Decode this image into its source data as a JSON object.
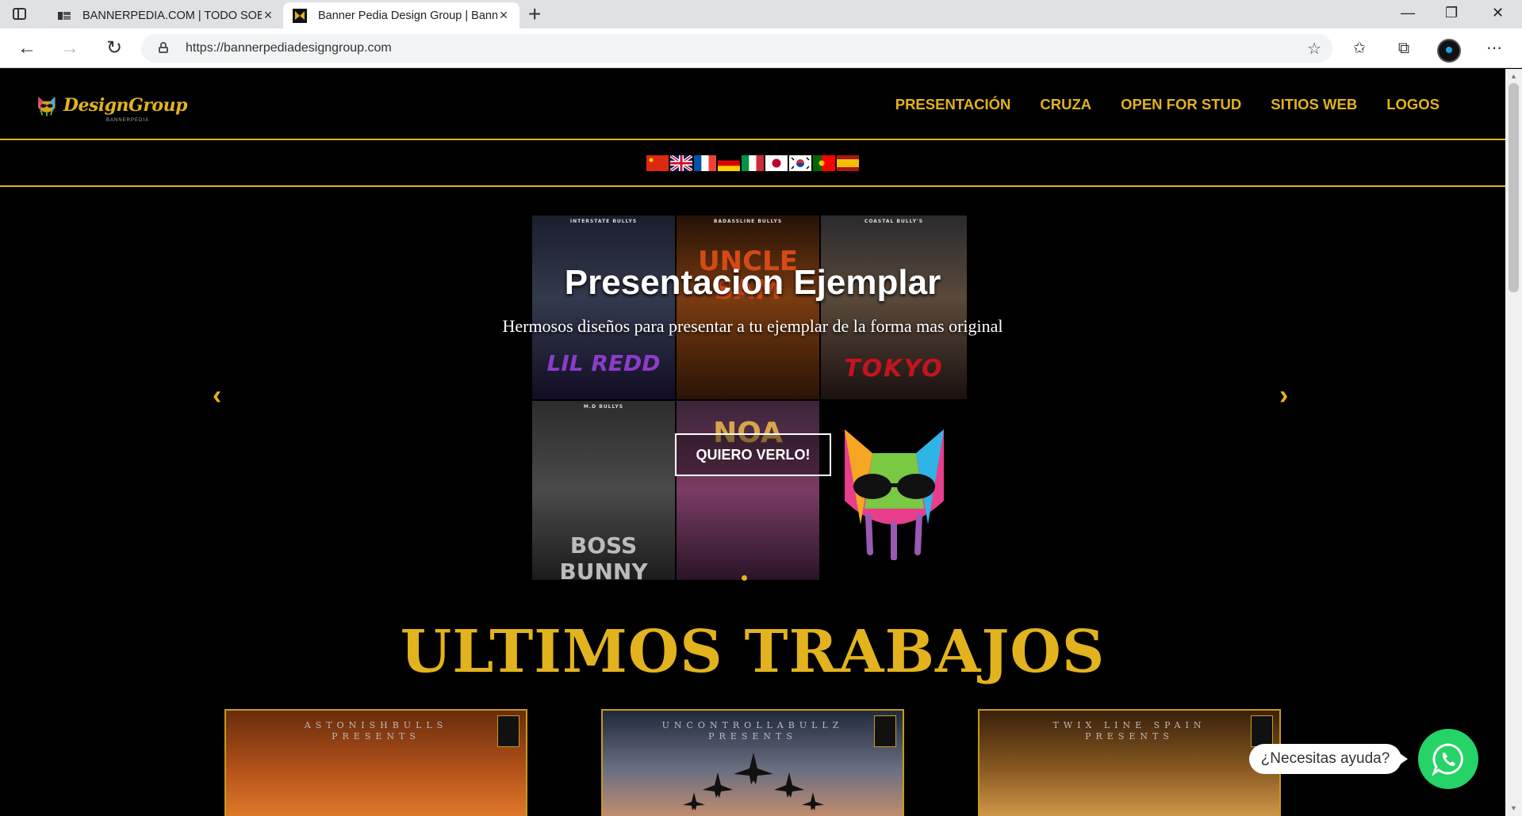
{
  "browser": {
    "tabs": [
      {
        "label": "BANNERPEDIA.COM | TODO SOBRE",
        "active": false
      },
      {
        "label": "Banner Pedia Design Group | Banner",
        "active": true
      }
    ],
    "url": "https://bannerpediadesigngroup.com",
    "new_tab_glyph": "+",
    "close_glyph": "×",
    "win_minimize": "—",
    "win_restore": "❐",
    "win_close": "✕",
    "nav": {
      "back": "←",
      "forward": "→",
      "reload": "↻"
    },
    "toolbar_icons": {
      "favorite": "☆",
      "favorites": "✩",
      "collections": "⧉",
      "more": "⋯"
    }
  },
  "site": {
    "logo": {
      "text": "DesignGroup",
      "sub": "BANNERPEDIA"
    },
    "nav": [
      "PRESENTACIÓN",
      "CRUZA",
      "OPEN FOR STUD",
      "SITIOS WEB",
      "LOGOS"
    ],
    "languages": [
      "zh",
      "en",
      "fr",
      "de",
      "it",
      "ja",
      "ko",
      "pt",
      "es"
    ]
  },
  "hero": {
    "title": "Presentacion Ejemplar",
    "subtitle": "Hermosos diseños para presentar a tu ejemplar de la forma mas original",
    "button": "QUIERO VERLO!",
    "prev": "‹",
    "next": "›",
    "posters": [
      {
        "top": "INTERSTATE BULLYS",
        "main": "LIL REDD"
      },
      {
        "top": "BADASSLINE BULLYS",
        "main": "UNCLE SAM"
      },
      {
        "top": "COASTAL BULLY'S",
        "main": "TOKYO"
      },
      {
        "top": "M.D BULLYS",
        "main": "BOSS BUNNY"
      },
      {
        "top": "",
        "main": "NOA"
      }
    ]
  },
  "works": {
    "title": "ULTIMOS TRABAJOS",
    "cards": [
      {
        "title": "ASTONISHBULLS",
        "sub": "PRESENTS"
      },
      {
        "title": "UNCONTROLLABULLZ",
        "sub": "PRESENTS"
      },
      {
        "title": "TWIX LINE SPAIN",
        "sub": "PRESENTS"
      }
    ]
  },
  "whatsapp": {
    "label": "¿Necesitas ayuda?"
  },
  "colors": {
    "gold": "#e2b31e",
    "whatsapp": "#25d366"
  }
}
